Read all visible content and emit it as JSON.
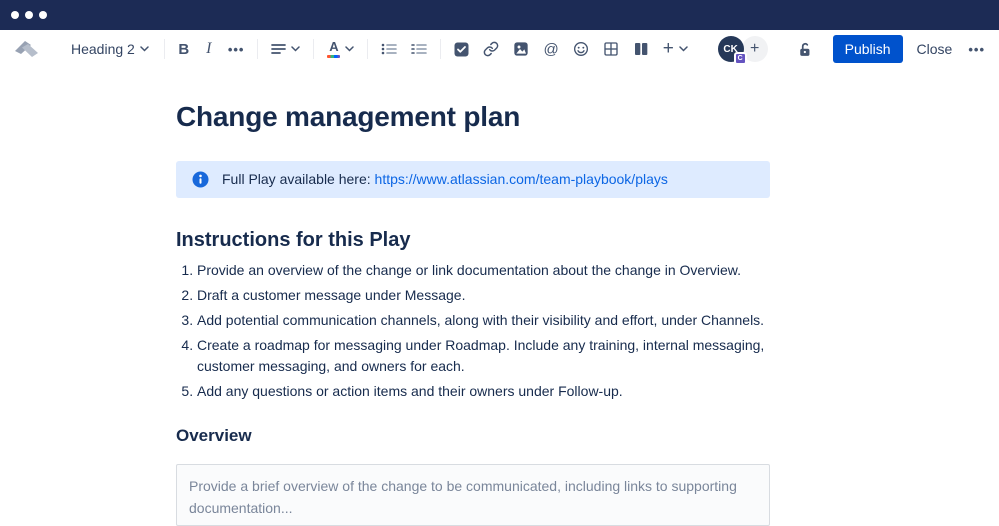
{
  "toolbar": {
    "block_style_value": "Heading 2",
    "bold_label": "B",
    "italic_label": "I",
    "more_label": "•••",
    "text_color_label": "A",
    "mention_label": "@",
    "insert_plus_label": "+",
    "invite_plus_label": "+",
    "avatar_initials": "CK",
    "avatar_badge": "C",
    "publish_label": "Publish",
    "close_label": "Close",
    "overflow_label": "•••"
  },
  "document": {
    "title": "Change management plan",
    "info_prefix": "Full Play available here: ",
    "info_link": "https://www.atlassian.com/team-playbook/plays",
    "instructions_heading": "Instructions for this Play",
    "instructions": [
      "Provide an overview of the change or link documentation about the change in Overview.",
      "Draft a customer message under Message.",
      "Add potential communication channels, along with their visibility and effort, under Channels.",
      "Create a roadmap for messaging under Roadmap. Include any training, internal messaging, customer messaging, and owners for each.",
      "Add any questions or action items and their owners under Follow-up."
    ],
    "overview_heading": "Overview",
    "overview_placeholder": "Provide a brief overview of the change to be communicated, including links to supporting documentation..."
  },
  "colors": {
    "topbar": "#1C2B55",
    "accent_blue": "#0052CC",
    "info_panel_bg": "#DEEBFF",
    "info_icon_blue": "#1868DB",
    "link_blue": "#0C66E4",
    "badge_purple": "#6554C0",
    "text": "#172B4D",
    "icon": "#44546F",
    "placeholder_text": "#7A869A"
  }
}
